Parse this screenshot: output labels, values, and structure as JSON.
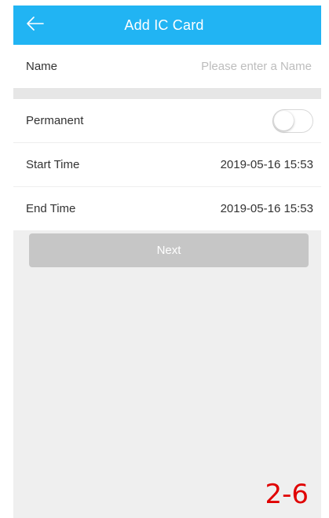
{
  "header": {
    "title": "Add IC Card",
    "back_icon": "arrow-left-icon"
  },
  "form": {
    "name": {
      "label": "Name",
      "value": "",
      "placeholder": "Please enter a Name"
    },
    "permanent": {
      "label": "Permanent",
      "enabled": false
    },
    "start_time": {
      "label": "Start Time",
      "value": "2019-05-16 15:53"
    },
    "end_time": {
      "label": "End Time",
      "value": "2019-05-16 15:53"
    }
  },
  "actions": {
    "next_label": "Next"
  },
  "annotation": {
    "label": "2-6"
  },
  "colors": {
    "header_bg": "#21b4f3",
    "page_bg": "#efefef",
    "button_disabled_bg": "#c6c6c6",
    "annotation": "#e00000"
  }
}
